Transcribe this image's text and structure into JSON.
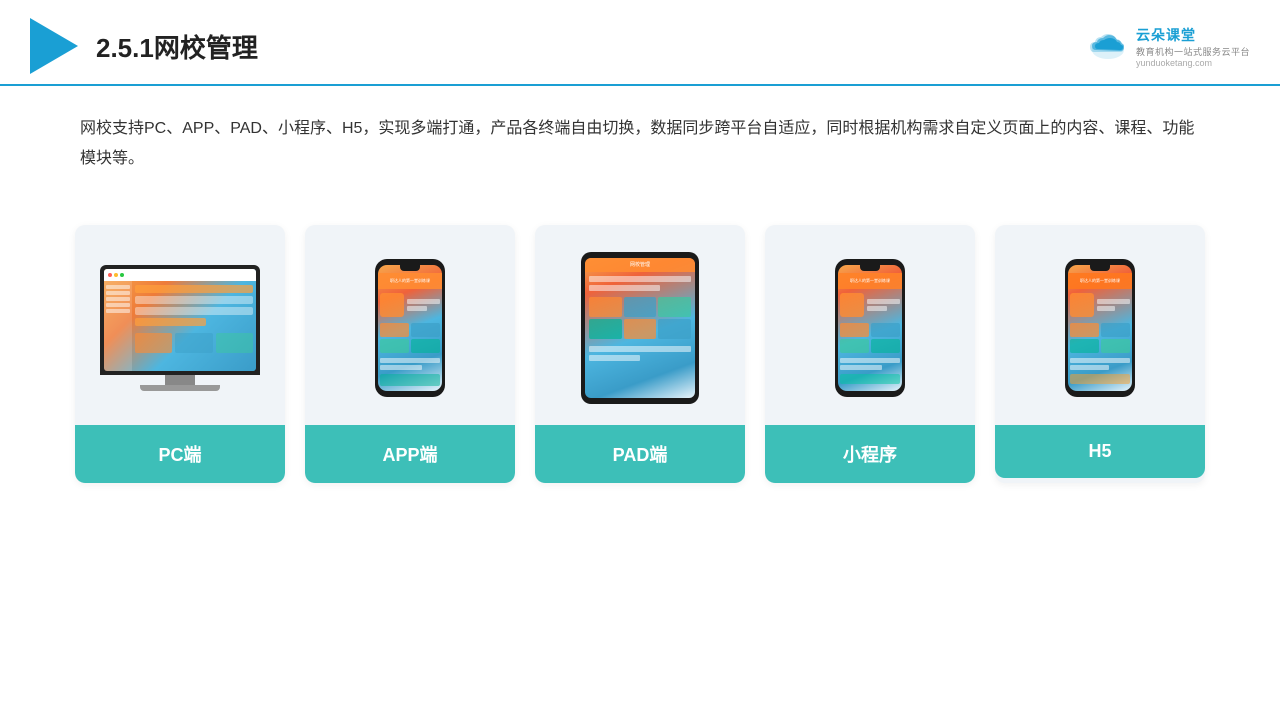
{
  "header": {
    "title": "2.5.1网校管理",
    "brand_name": "云朵课堂",
    "brand_url": "yunduoketang.com",
    "brand_tag_line": "教育机构一站\n式服务云平台"
  },
  "description": "网校支持PC、APP、PAD、小程序、H5，实现多端打通，产品各终端自由切换，数据同步跨平台自适应，同时根据机构需求自定义页面上的内容、课程、功能模块等。",
  "cards": [
    {
      "id": "pc",
      "label": "PC端",
      "type": "pc"
    },
    {
      "id": "app",
      "label": "APP端",
      "type": "phone"
    },
    {
      "id": "pad",
      "label": "PAD端",
      "type": "ipad"
    },
    {
      "id": "miniprogram",
      "label": "小程序",
      "type": "phone2"
    },
    {
      "id": "h5",
      "label": "H5",
      "type": "phone3"
    }
  ]
}
